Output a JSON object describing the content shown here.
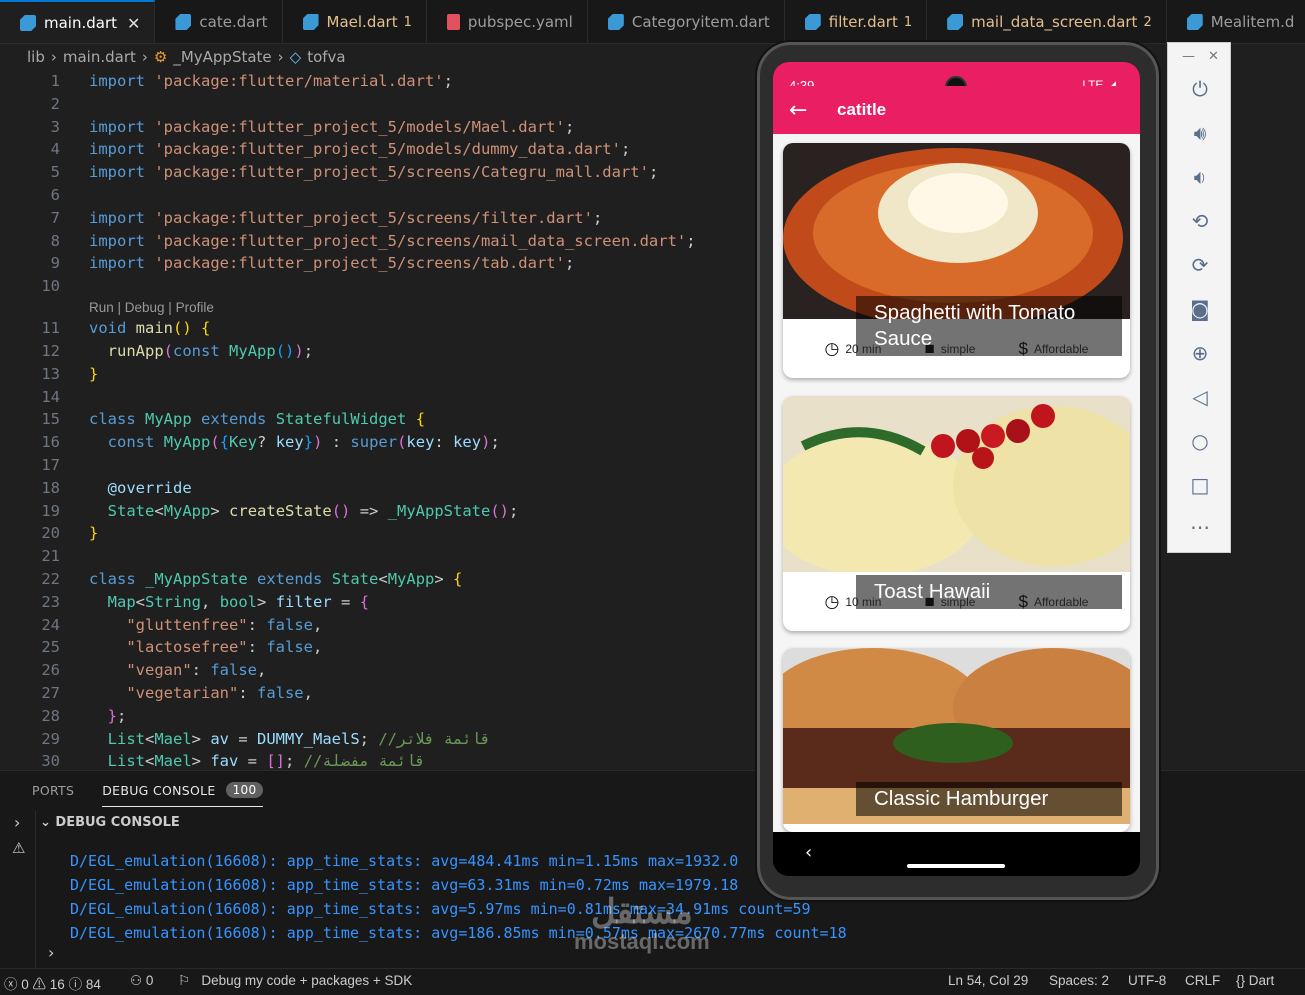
{
  "tabs": [
    {
      "label": "main.dart",
      "active": true,
      "type": "dart",
      "count": ""
    },
    {
      "label": "cate.dart",
      "type": "dart",
      "count": ""
    },
    {
      "label": "Mael.dart",
      "type": "dart",
      "count": "1",
      "warn": true
    },
    {
      "label": "pubspec.yaml",
      "type": "yaml",
      "count": ""
    },
    {
      "label": "Categoryitem.dart",
      "type": "dart",
      "count": ""
    },
    {
      "label": "filter.dart",
      "type": "dart",
      "count": "1",
      "warn": true
    },
    {
      "label": "mail_data_screen.dart",
      "type": "dart",
      "count": "2",
      "warn": true
    },
    {
      "label": "Mealitem.d",
      "type": "dart",
      "count": ""
    }
  ],
  "breadcrumb": {
    "a": "lib",
    "b": "main.dart",
    "c": "_MyAppState",
    "d": "tofva"
  },
  "codelens": "Run | Debug | Profile",
  "panel": {
    "ports": "PORTS",
    "debug": "DEBUG CONSOLE",
    "badge": "100",
    "header": "DEBUG CONSOLE"
  },
  "logs": [
    "D/EGL_emulation(16608): app_time_stats: avg=484.41ms min=1.15ms max=1932.0",
    "D/EGL_emulation(16608): app_time_stats: avg=63.31ms min=0.72ms max=1979.18",
    "D/EGL_emulation(16608): app_time_stats: avg=5.97ms min=0.81ms max=34.91ms count=59",
    "D/EGL_emulation(16608): app_time_stats: avg=186.85ms min=0.57ms max=2670.77ms count=18"
  ],
  "status": {
    "errors": "0",
    "warnings": "16",
    "info": "84",
    "ports": "0",
    "debug": "Debug my code + packages + SDK",
    "pos": "Ln 54, Col 29",
    "spaces": "Spaces: 2",
    "enc": "UTF-8",
    "eol": "CRLF",
    "lang": "Dart"
  },
  "watermark": "mostaql.com",
  "phone": {
    "time": "4:39",
    "network": "LTE",
    "title": "catitle"
  },
  "meals": [
    {
      "title": "Spaghetti with Tomato Sauce",
      "duration": "20 min",
      "complexity": "simple",
      "affordability": "Affordable"
    },
    {
      "title": "Toast Hawaii",
      "duration": "10 min",
      "complexity": "simple",
      "affordability": "Affordable"
    },
    {
      "title": "Classic Hamburger",
      "duration": "",
      "complexity": "",
      "affordability": ""
    }
  ],
  "toolbar": [
    "power-icon",
    "volume-up-icon",
    "volume-down-icon",
    "rotate-left-icon",
    "rotate-right-icon",
    "camera-icon",
    "zoom-icon",
    "back-icon",
    "home-icon",
    "overview-icon",
    "more-icon"
  ]
}
